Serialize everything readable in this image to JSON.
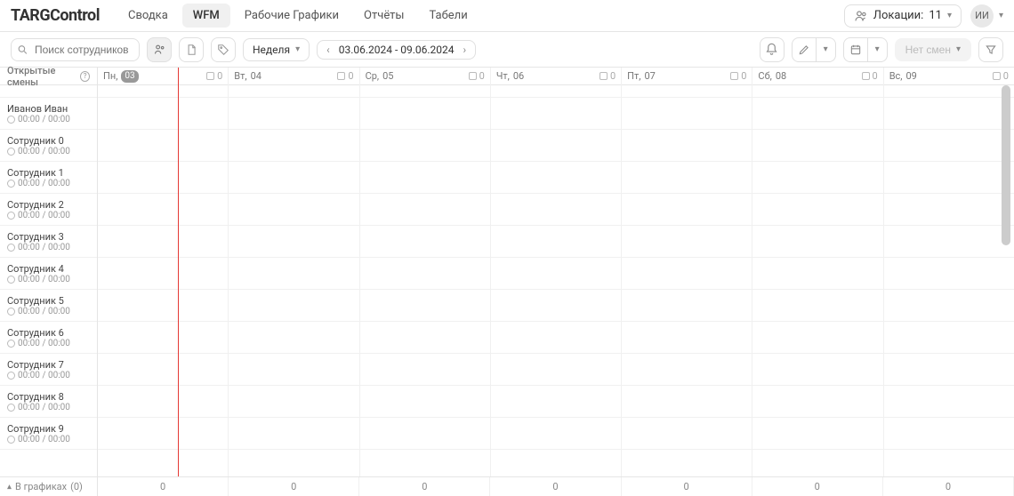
{
  "brand": "TARGControl",
  "nav": {
    "items": [
      "Сводка",
      "WFM",
      "Рабочие Графики",
      "Отчёты",
      "Табели"
    ],
    "active_index": 1
  },
  "location": {
    "label": "Локации:",
    "value": "11"
  },
  "user": {
    "initials": "ИИ"
  },
  "search": {
    "placeholder": "Поиск сотрудников"
  },
  "period_selector": {
    "label": "Неделя"
  },
  "date_range": {
    "text": "03.06.2024 - 09.06.2024"
  },
  "no_shifts_button": {
    "label": "Нет смен"
  },
  "open_shifts": {
    "label": "Открытые смены"
  },
  "days": [
    {
      "short": "Пн",
      "date": "03",
      "is_today": true,
      "count": "0"
    },
    {
      "short": "Вт",
      "date": "04",
      "is_today": false,
      "count": "0"
    },
    {
      "short": "Ср",
      "date": "05",
      "is_today": false,
      "count": "0"
    },
    {
      "short": "Чт",
      "date": "06",
      "is_today": false,
      "count": "0"
    },
    {
      "short": "Пт",
      "date": "07",
      "is_today": false,
      "count": "0"
    },
    {
      "short": "Сб",
      "date": "08",
      "is_today": false,
      "count": "0"
    },
    {
      "short": "Вс",
      "date": "09",
      "is_today": false,
      "count": "0"
    }
  ],
  "employees": [
    {
      "name": "Иванов Иван",
      "time": "00:00 / 00:00"
    },
    {
      "name": "Сотрудник 0",
      "time": "00:00 / 00:00"
    },
    {
      "name": "Сотрудник 1",
      "time": "00:00 / 00:00"
    },
    {
      "name": "Сотрудник 2",
      "time": "00:00 / 00:00"
    },
    {
      "name": "Сотрудник 3",
      "time": "00:00 / 00:00"
    },
    {
      "name": "Сотрудник 4",
      "time": "00:00 / 00:00"
    },
    {
      "name": "Сотрудник 5",
      "time": "00:00 / 00:00"
    },
    {
      "name": "Сотрудник 6",
      "time": "00:00 / 00:00"
    },
    {
      "name": "Сотрудник 7",
      "time": "00:00 / 00:00"
    },
    {
      "name": "Сотрудник 8",
      "time": "00:00 / 00:00"
    },
    {
      "name": "Сотрудник 9",
      "time": "00:00 / 00:00"
    }
  ],
  "footer": {
    "label": "В графиках",
    "count_suffix": "(0)",
    "day_totals": [
      "0",
      "0",
      "0",
      "0",
      "0",
      "0",
      "0"
    ]
  }
}
